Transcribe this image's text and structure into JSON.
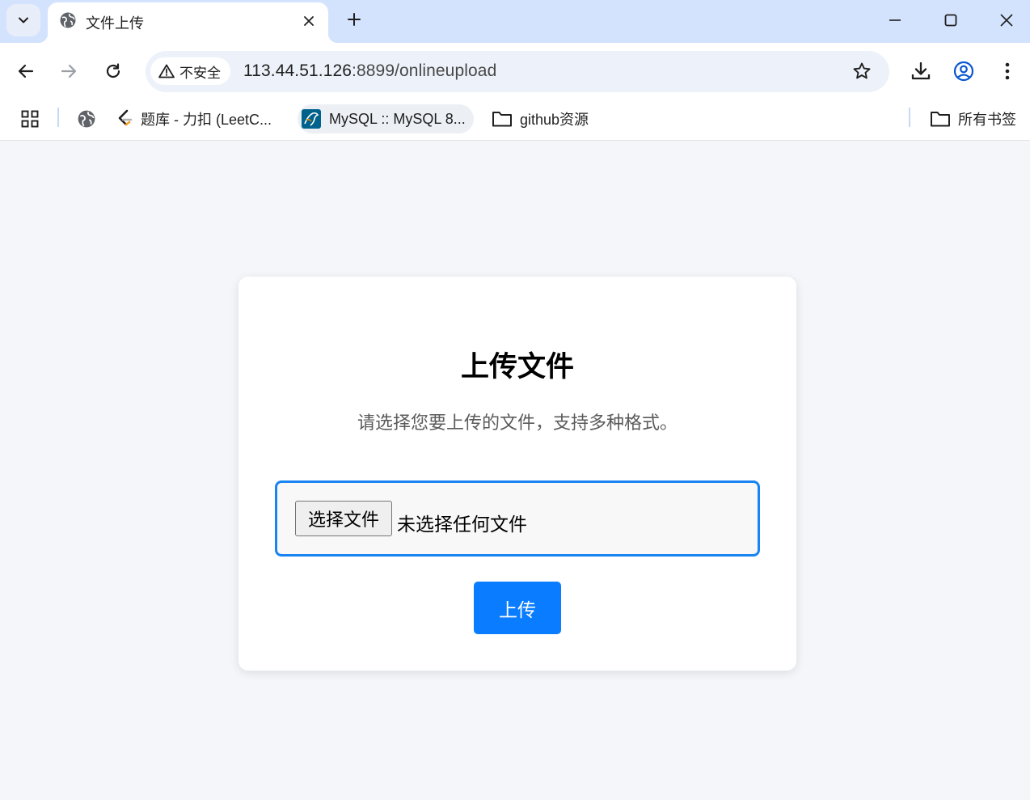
{
  "browser": {
    "tab": {
      "title": "文件上传"
    },
    "address_bar": {
      "security_label": "不安全",
      "url_host": "113.44.51.126",
      "url_path": ":8899/onlineupload"
    },
    "bookmarks": [
      {
        "label": "题库 - 力扣 (LeetC..."
      },
      {
        "label": "MySQL :: MySQL 8..."
      },
      {
        "label": "github资源"
      }
    ],
    "all_bookmarks_label": "所有书签"
  },
  "page": {
    "title": "上传文件",
    "description": "请选择您要上传的文件，支持多种格式。",
    "file_input": {
      "button_label": "选择文件",
      "status": "未选择任何文件"
    },
    "upload_button_label": "上传"
  },
  "colors": {
    "accent": "#0a7cff",
    "input_border": "#1a84f2",
    "tabstrip": "#d3e3fd",
    "page_bg": "#f4f6fa"
  }
}
